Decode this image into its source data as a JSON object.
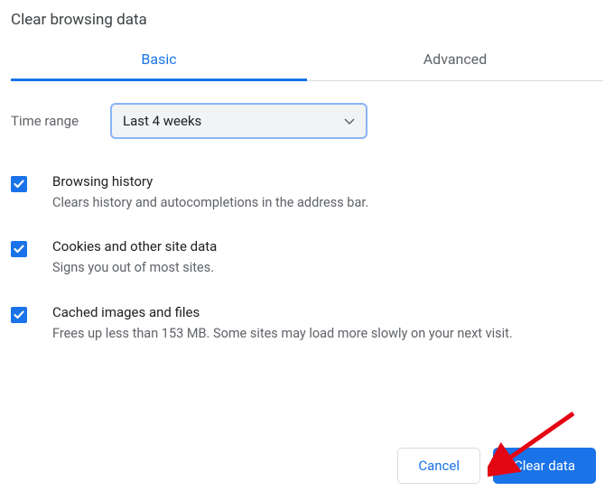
{
  "dialog": {
    "title": "Clear browsing data",
    "tabs": {
      "basic": "Basic",
      "advanced": "Advanced"
    },
    "time_range": {
      "label": "Time range",
      "value": "Last 4 weeks"
    },
    "options": [
      {
        "title": "Browsing history",
        "description": "Clears history and autocompletions in the address bar.",
        "checked": true
      },
      {
        "title": "Cookies and other site data",
        "description": "Signs you out of most sites.",
        "checked": true
      },
      {
        "title": "Cached images and files",
        "description": "Frees up less than 153 MB. Some sites may load more slowly on your next visit.",
        "checked": true
      }
    ],
    "buttons": {
      "cancel": "Cancel",
      "clear": "Clear data"
    }
  }
}
